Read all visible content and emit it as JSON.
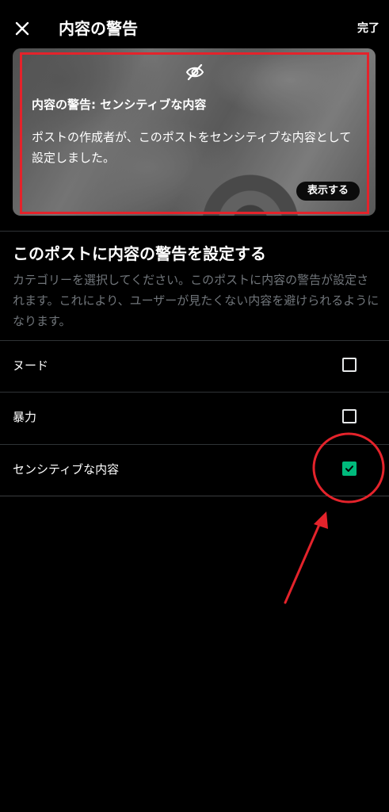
{
  "header": {
    "title": "内容の警告",
    "done_label": "完了"
  },
  "preview": {
    "warning_title": "内容の警告: センシティブな内容",
    "warning_body": "ポストの作成者が、このポストをセンシティブな内容として設定しました。",
    "show_label": "表示する"
  },
  "section": {
    "title": "このポストに内容の警告を設定する",
    "description": "カテゴリーを選択してください。このポストに内容の警告が設定されます。これにより、ユーザーが見たくない内容を避けられるようになります。"
  },
  "options": [
    {
      "label": "ヌード",
      "checked": false
    },
    {
      "label": "暴力",
      "checked": false
    },
    {
      "label": "センシティブな内容",
      "checked": true
    }
  ],
  "colors": {
    "background": "#000000",
    "accent_green": "#00ba7c",
    "annotation_red": "#e4232b",
    "muted_text": "#71767b",
    "divider": "#2f3336"
  },
  "icons": {
    "close": "close-icon",
    "hidden": "eye-off-icon",
    "check": "check-icon"
  }
}
